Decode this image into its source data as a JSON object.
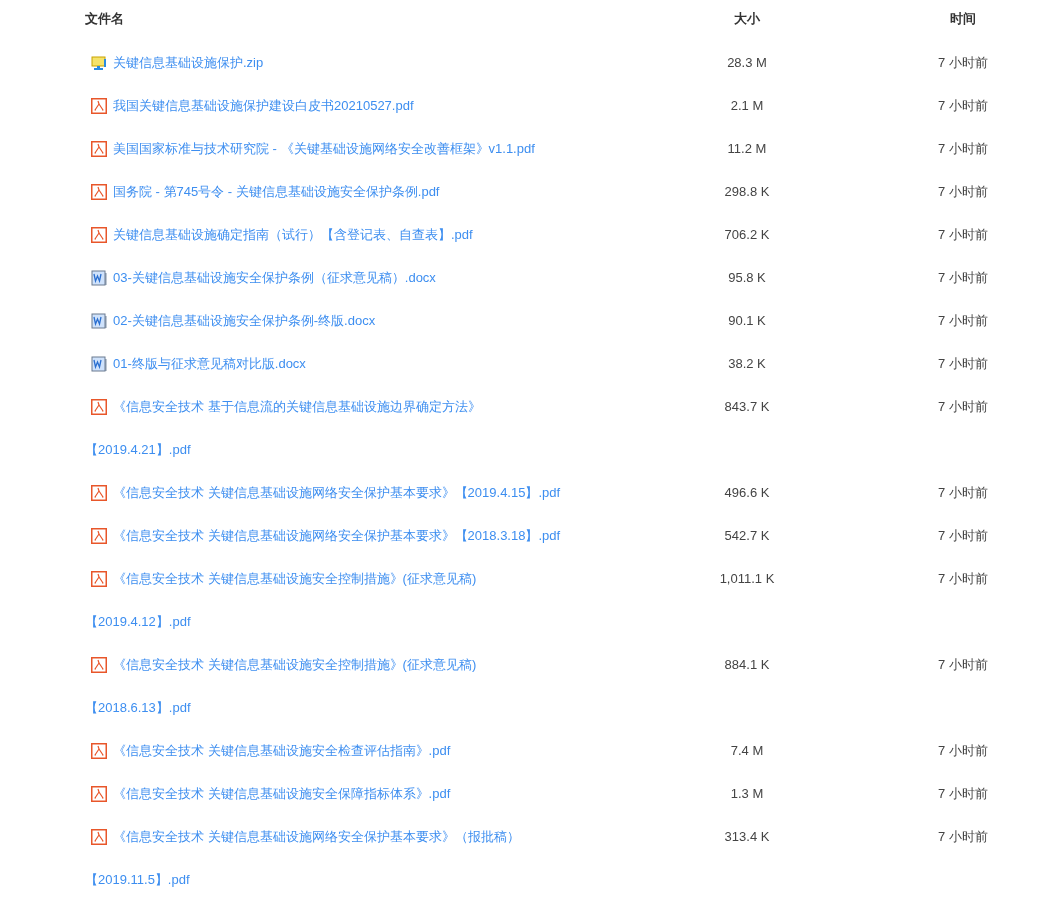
{
  "columns": [
    {
      "label": "文件名"
    },
    {
      "label": "大小"
    },
    {
      "label": "时间"
    }
  ],
  "files": [
    {
      "kind": "zip",
      "name": "关键信息基础设施保护.zip",
      "size": "28.3 M",
      "time": "7 小时前"
    },
    {
      "kind": "pdf",
      "name": "我国关键信息基础设施保护建设白皮书20210527.pdf",
      "size": "2.1 M",
      "time": "7 小时前"
    },
    {
      "kind": "pdf",
      "name": "美国国家标准与技术研究院 - 《关键基础设施网络安全改善框架》v1.1.pdf",
      "size": "11.2 M",
      "time": "7 小时前"
    },
    {
      "kind": "pdf",
      "name": "国务院 - 第745号令 - 关键信息基础设施安全保护条例.pdf",
      "size": "298.8 K",
      "time": "7 小时前"
    },
    {
      "kind": "pdf",
      "name": "关键信息基础设施确定指南（试行）【含登记表、自查表】.pdf",
      "size": "706.2 K",
      "time": "7 小时前"
    },
    {
      "kind": "docx",
      "name": "03-关键信息基础设施安全保护条例（征求意见稿）.docx",
      "size": "95.8 K",
      "time": "7 小时前"
    },
    {
      "kind": "docx",
      "name": "02-关键信息基础设施安全保护条例-终版.docx",
      "size": "90.1 K",
      "time": "7 小时前"
    },
    {
      "kind": "docx",
      "name": "01-终版与征求意见稿对比版.docx",
      "size": "38.2 K",
      "time": "7 小时前"
    },
    {
      "kind": "pdf",
      "name": "《信息安全技术 基于信息流的关键信息基础设施边界确定方法》",
      "name_continued": "【2019.4.21】.pdf",
      "size": "843.7 K",
      "time": "7 小时前"
    },
    {
      "kind": "pdf",
      "name": "《信息安全技术 关键信息基础设施网络安全保护基本要求》【2019.4.15】.pdf",
      "size": "496.6 K",
      "time": "7 小时前"
    },
    {
      "kind": "pdf",
      "name": "《信息安全技术 关键信息基础设施网络安全保护基本要求》【2018.3.18】.pdf",
      "size": "542.7 K",
      "time": "7 小时前"
    },
    {
      "kind": "pdf",
      "name": "《信息安全技术 关键信息基础设施安全控制措施》(征求意见稿)",
      "name_continued": "【2019.4.12】.pdf",
      "size": "1,011.1 K",
      "time": "7 小时前"
    },
    {
      "kind": "pdf",
      "name": "《信息安全技术 关键信息基础设施安全控制措施》(征求意见稿)",
      "name_continued": "【2018.6.13】.pdf",
      "size": "884.1 K",
      "time": "7 小时前"
    },
    {
      "kind": "pdf",
      "name": "《信息安全技术 关键信息基础设施安全检查评估指南》.pdf",
      "size": "7.4 M",
      "time": "7 小时前"
    },
    {
      "kind": "pdf",
      "name": "《信息安全技术 关键信息基础设施安全保障指标体系》.pdf",
      "size": "1.3 M",
      "time": "7 小时前"
    },
    {
      "kind": "pdf",
      "name": "《信息安全技术 关键信息基础设施网络安全保护基本要求》（报批稿）",
      "name_continued": "【2019.11.5】.pdf",
      "size": "313.4 K",
      "time": "7 小时前"
    }
  ]
}
